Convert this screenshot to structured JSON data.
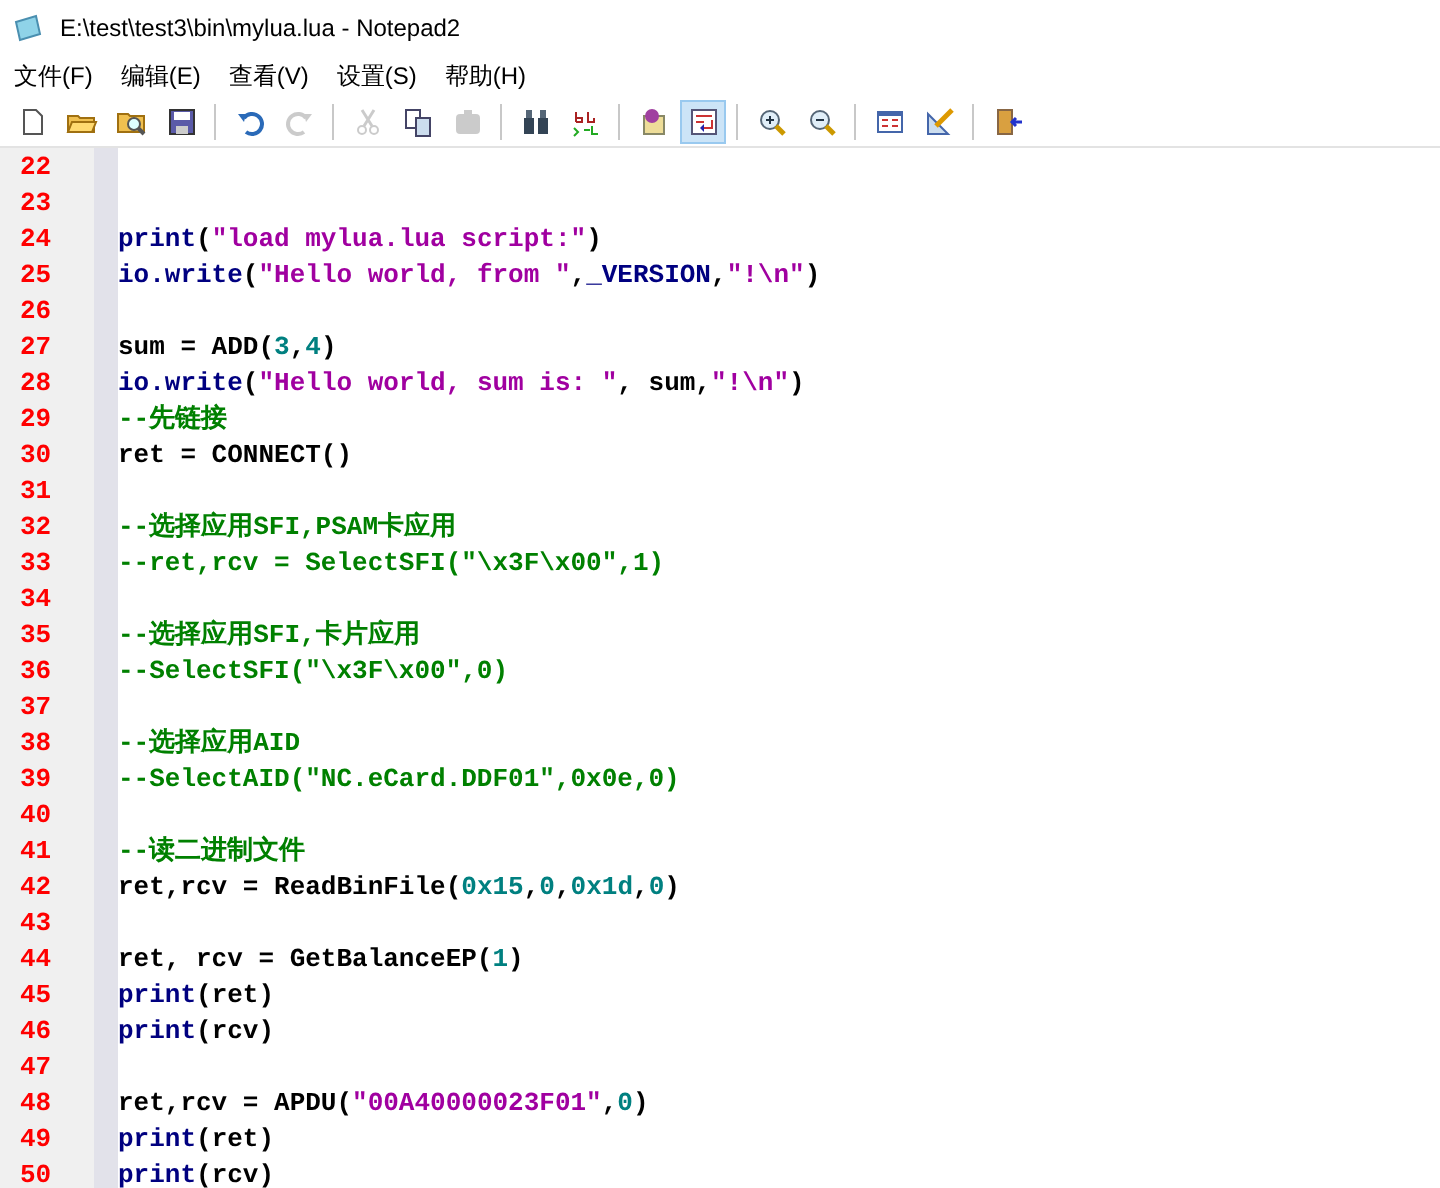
{
  "window": {
    "title": "E:\\test\\test3\\bin\\mylua.lua - Notepad2"
  },
  "menu": [
    "文件(F)",
    "编辑(E)",
    "查看(V)",
    "设置(S)",
    "帮助(H)"
  ],
  "toolbar": [
    {
      "kind": "new",
      "disabled": false,
      "selected": false
    },
    {
      "kind": "open",
      "disabled": false,
      "selected": false
    },
    {
      "kind": "browse",
      "disabled": false,
      "selected": false
    },
    {
      "kind": "save",
      "disabled": false,
      "selected": false
    },
    {
      "kind": "separator"
    },
    {
      "kind": "undo",
      "disabled": false,
      "selected": false
    },
    {
      "kind": "redo",
      "disabled": true,
      "selected": false
    },
    {
      "kind": "separator"
    },
    {
      "kind": "cut",
      "disabled": true,
      "selected": false
    },
    {
      "kind": "copy",
      "disabled": false,
      "selected": false
    },
    {
      "kind": "paste",
      "disabled": true,
      "selected": false
    },
    {
      "kind": "separator"
    },
    {
      "kind": "find",
      "disabled": false,
      "selected": false
    },
    {
      "kind": "replace",
      "disabled": false,
      "selected": false
    },
    {
      "kind": "separator"
    },
    {
      "kind": "note",
      "disabled": false,
      "selected": false
    },
    {
      "kind": "wrap",
      "disabled": false,
      "selected": true
    },
    {
      "kind": "separator"
    },
    {
      "kind": "zoom_in",
      "disabled": false,
      "selected": false
    },
    {
      "kind": "zoom_out",
      "disabled": false,
      "selected": false
    },
    {
      "kind": "separator"
    },
    {
      "kind": "scheme",
      "disabled": false,
      "selected": false
    },
    {
      "kind": "ruler",
      "disabled": false,
      "selected": false
    },
    {
      "kind": "separator"
    },
    {
      "kind": "exit",
      "disabled": false,
      "selected": false
    }
  ],
  "editor": {
    "lines": [
      {
        "number": "22"
      },
      {
        "number": "23"
      },
      {
        "number": "24",
        "tokens": [
          {
            "kind": "keyword",
            "text": "print"
          },
          {
            "kind": "plain",
            "text": "("
          },
          {
            "kind": "string",
            "text": "\"load mylua.lua script:\""
          },
          {
            "kind": "plain",
            "text": ")"
          }
        ]
      },
      {
        "number": "25",
        "tokens": [
          {
            "kind": "keyword",
            "text": "io.write"
          },
          {
            "kind": "plain",
            "text": "("
          },
          {
            "kind": "string",
            "text": "\"Hello world, from \""
          },
          {
            "kind": "plain",
            "text": ","
          },
          {
            "kind": "keyword",
            "text": "_VERSION"
          },
          {
            "kind": "plain",
            "text": ","
          },
          {
            "kind": "string",
            "text": "\"!\\n\""
          },
          {
            "kind": "plain",
            "text": ")"
          }
        ]
      },
      {
        "number": "26"
      },
      {
        "number": "27",
        "tokens": [
          {
            "kind": "plain",
            "text": "sum = ADD("
          },
          {
            "kind": "number",
            "text": "3"
          },
          {
            "kind": "plain",
            "text": ","
          },
          {
            "kind": "number",
            "text": "4"
          },
          {
            "kind": "plain",
            "text": ")"
          }
        ]
      },
      {
        "number": "28",
        "tokens": [
          {
            "kind": "keyword",
            "text": "io.write"
          },
          {
            "kind": "plain",
            "text": "("
          },
          {
            "kind": "string",
            "text": "\"Hello world, sum is: \""
          },
          {
            "kind": "plain",
            "text": ", sum,"
          },
          {
            "kind": "string",
            "text": "\"!\\n\""
          },
          {
            "kind": "plain",
            "text": ")"
          }
        ]
      },
      {
        "number": "29",
        "tokens": [
          {
            "kind": "comment",
            "text": "--先链接"
          }
        ]
      },
      {
        "number": "30",
        "tokens": [
          {
            "kind": "plain",
            "text": "ret = CONNECT()"
          }
        ]
      },
      {
        "number": "31"
      },
      {
        "number": "32",
        "tokens": [
          {
            "kind": "comment",
            "text": "--选择应用SFI,PSAM卡应用"
          }
        ]
      },
      {
        "number": "33",
        "tokens": [
          {
            "kind": "comment",
            "text": "--ret,rcv = SelectSFI(\"\\x3F\\x00\",1)"
          }
        ]
      },
      {
        "number": "34"
      },
      {
        "number": "35",
        "tokens": [
          {
            "kind": "comment",
            "text": "--选择应用SFI,卡片应用"
          }
        ]
      },
      {
        "number": "36",
        "tokens": [
          {
            "kind": "comment",
            "text": "--SelectSFI(\"\\x3F\\x00\",0)"
          }
        ]
      },
      {
        "number": "37"
      },
      {
        "number": "38",
        "tokens": [
          {
            "kind": "comment",
            "text": "--选择应用AID"
          }
        ]
      },
      {
        "number": "39",
        "tokens": [
          {
            "kind": "comment",
            "text": "--SelectAID(\"NC.eCard.DDF01\",0x0e,0)"
          }
        ]
      },
      {
        "number": "40"
      },
      {
        "number": "41",
        "tokens": [
          {
            "kind": "comment",
            "text": "--读二进制文件"
          }
        ]
      },
      {
        "number": "42",
        "tokens": [
          {
            "kind": "plain",
            "text": "ret,rcv = ReadBinFile("
          },
          {
            "kind": "number",
            "text": "0x15"
          },
          {
            "kind": "plain",
            "text": ","
          },
          {
            "kind": "number",
            "text": "0"
          },
          {
            "kind": "plain",
            "text": ","
          },
          {
            "kind": "number",
            "text": "0x1d"
          },
          {
            "kind": "plain",
            "text": ","
          },
          {
            "kind": "number",
            "text": "0"
          },
          {
            "kind": "plain",
            "text": ")"
          }
        ]
      },
      {
        "number": "43"
      },
      {
        "number": "44",
        "tokens": [
          {
            "kind": "plain",
            "text": "ret, rcv = GetBalanceEP("
          },
          {
            "kind": "number",
            "text": "1"
          },
          {
            "kind": "plain",
            "text": ")"
          }
        ]
      },
      {
        "number": "45",
        "tokens": [
          {
            "kind": "keyword",
            "text": "print"
          },
          {
            "kind": "plain",
            "text": "(ret)"
          }
        ]
      },
      {
        "number": "46",
        "tokens": [
          {
            "kind": "keyword",
            "text": "print"
          },
          {
            "kind": "plain",
            "text": "(rcv)"
          }
        ]
      },
      {
        "number": "47"
      },
      {
        "number": "48",
        "tokens": [
          {
            "kind": "plain",
            "text": "ret,rcv = APDU("
          },
          {
            "kind": "string",
            "text": "\"00A40000023F01\""
          },
          {
            "kind": "plain",
            "text": ","
          },
          {
            "kind": "number",
            "text": "0"
          },
          {
            "kind": "plain",
            "text": ")"
          }
        ]
      },
      {
        "number": "49",
        "tokens": [
          {
            "kind": "keyword",
            "text": "print"
          },
          {
            "kind": "plain",
            "text": "(ret)"
          }
        ]
      },
      {
        "number": "50",
        "tokens": [
          {
            "kind": "keyword",
            "text": "print"
          },
          {
            "kind": "plain",
            "text": "(rcv)"
          }
        ]
      }
    ]
  }
}
